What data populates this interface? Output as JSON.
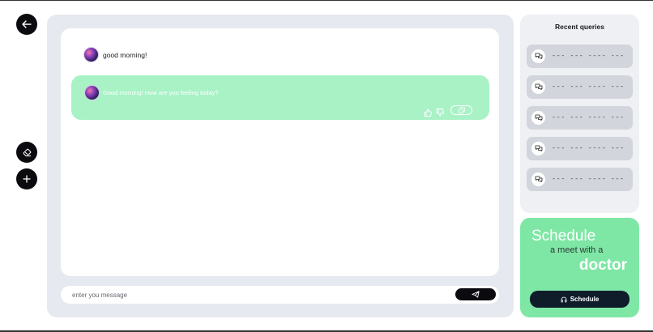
{
  "left_rail": {
    "back_icon": "arrow-left-icon",
    "eraser_icon": "eraser-icon",
    "add_icon": "plus-icon"
  },
  "chat": {
    "messages": [
      {
        "role": "user",
        "text": "good morning!"
      },
      {
        "role": "assistant",
        "text": "Good morning! How are you feeling today?"
      }
    ],
    "input_placeholder": "enter you message",
    "send_icon": "send-icon"
  },
  "recent": {
    "title": "Recent queries",
    "items": [
      {
        "text": "--- --- ---- ---"
      },
      {
        "text": "--- --- ---- ---"
      },
      {
        "text": "--- --- ---- ---"
      },
      {
        "text": "--- --- ---- ---"
      },
      {
        "text": "--- --- ---- ---"
      }
    ]
  },
  "schedule": {
    "line1": "Schedule",
    "line2": "a meet with a",
    "line3": "doctor",
    "button_label": "Schedule"
  },
  "colors": {
    "accent_green": "#7fe7a6",
    "bubble_green": "#a8f2c6",
    "dark": "#0b0b0f",
    "panel_bg": "#e6e9ef"
  }
}
